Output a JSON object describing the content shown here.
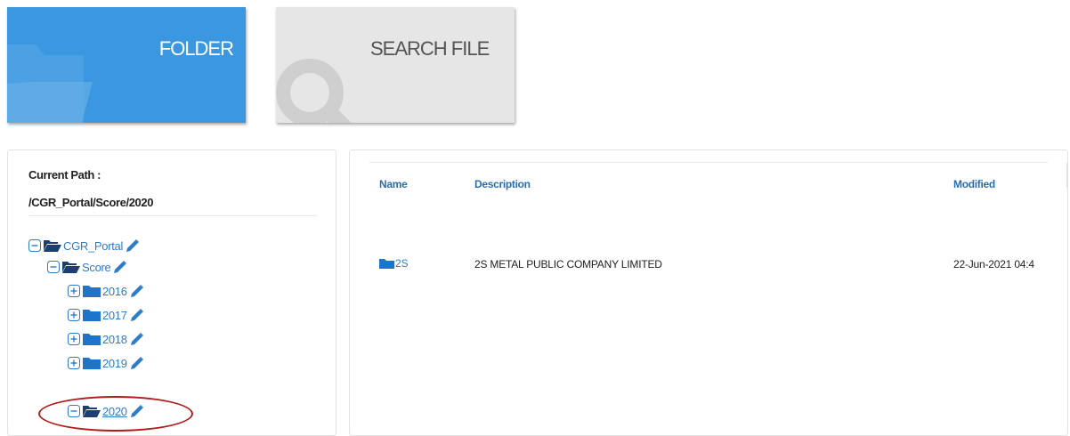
{
  "tiles": {
    "folder_label": "FOLDER",
    "search_label": "SEARCH FILE",
    "folder_color": "#3b98e0",
    "search_color": "#e6e6e6"
  },
  "sidebar": {
    "path_label": "Current Path :",
    "path_value": "/CGR_Portal/Score/2020",
    "tree": [
      {
        "label": "CGR_Portal",
        "toggle": "minus",
        "icon": "folder-open-icon"
      },
      {
        "label": "Score",
        "toggle": "minus",
        "icon": "folder-open-icon"
      },
      {
        "label": "2016",
        "toggle": "plus",
        "icon": "folder-icon"
      },
      {
        "label": "2017",
        "toggle": "plus",
        "icon": "folder-icon"
      },
      {
        "label": "2018",
        "toggle": "plus",
        "icon": "folder-icon"
      },
      {
        "label": "2019",
        "toggle": "plus",
        "icon": "folder-icon"
      },
      {
        "label": "2020",
        "toggle": "minus",
        "icon": "folder-open-icon",
        "selected": true
      }
    ]
  },
  "table": {
    "headers": {
      "name": "Name",
      "description": "Description",
      "modified": "Modified"
    },
    "rows": [
      {
        "name": "2S",
        "description": "2S METAL PUBLIC COMPANY LIMITED",
        "modified": "22-Jun-2021 04:4"
      }
    ]
  },
  "colors": {
    "link": "#2f7cc6",
    "header": "#2a6db5",
    "selection_ring": "#b01c1c"
  }
}
